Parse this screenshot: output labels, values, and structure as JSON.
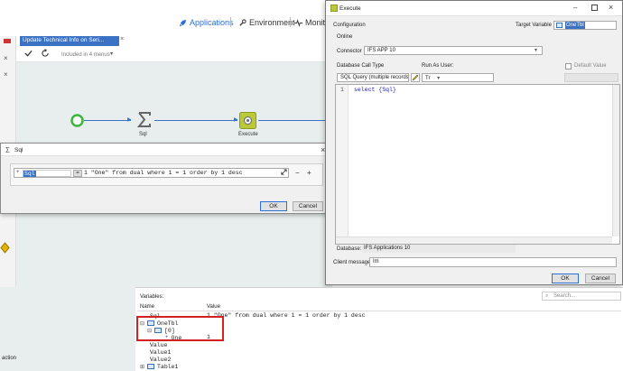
{
  "nav": {
    "applications": "Applications",
    "environment": "Environment",
    "monitoring": "Monit"
  },
  "workflow": {
    "tab_title": "Update Technical Info on Seri...",
    "menus_text": "Included in 4 menus",
    "nodes": {
      "sql": "Sql",
      "execute": "Execute"
    },
    "left_text": "action"
  },
  "sql_dialog": {
    "title": "Sql",
    "variable": "Sql",
    "expression": "1 \"One\" from dual where 1 = 1 order by 1 desc",
    "ok": "OK",
    "cancel": "Cancel"
  },
  "execute_dialog": {
    "title": "Execute",
    "configuration": "Configuration",
    "target_variable_label": "Target Variable",
    "target_variable": "OneTbl",
    "online": "Online",
    "connector_label": "Connector",
    "connector": "IFS APP 10",
    "call_type_label": "Database Call Type",
    "call_type": "SQL Query (multiple records",
    "run_as_label": "Run As User:",
    "run_as": "Tr",
    "default_value": "Default Value",
    "line_number": "1",
    "code": "select {Sql}",
    "database_label": "Database:",
    "database": "IFS Applications 10",
    "client_message_label": "Client message",
    "client_message": "Im",
    "ok": "OK",
    "cancel": "Cancel"
  },
  "variables": {
    "header": "Variables:",
    "search_placeholder": "Search...",
    "col_name": "Name",
    "col_value": "Value",
    "rows": [
      {
        "name": "Sql",
        "value": "1 \"One\" from dual where 1 = 1 order by 1 desc"
      },
      {
        "name": "OneTbl",
        "value": ""
      },
      {
        "name": "[0]",
        "value": ""
      },
      {
        "name": "One",
        "value": "1"
      },
      {
        "name": "Value",
        "value": ""
      },
      {
        "name": "Value1",
        "value": ""
      },
      {
        "name": "Value2",
        "value": ""
      },
      {
        "name": "Table1",
        "value": ""
      }
    ]
  },
  "colors": {
    "accent": "#2a6fd6",
    "tab_blue": "#3b72c4",
    "start_green": "#3cb63c",
    "highlight_red": "#d32020"
  }
}
